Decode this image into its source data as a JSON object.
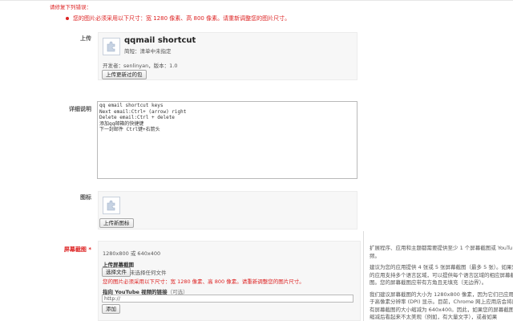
{
  "top_warning": "请修复下列错误：",
  "image_size_warning": "您的图片必须采用以下尺寸：宽 1280 像素、高 800 像素。请重新调整您的图片尺寸。",
  "upload": {
    "label": "上传",
    "app_name": "qqmail shortcut",
    "summary_label": "简短：",
    "summary_value": "清单中未指定",
    "meta": "开发者：senlinyan，版本：1.0",
    "button": "上传更新过的包"
  },
  "description": {
    "label": "详细说明",
    "lines": [
      "qq email shortcut keys",
      "Next email:Ctrl+ (arrow) right",
      "Delete email:Ctrl + delete",
      "添加qq邮箱的快捷键",
      "下一封邮件 Ctrl键+右箭头"
    ]
  },
  "icon": {
    "label": "图标",
    "button": "上传新图标"
  },
  "screenshots": {
    "label": "屏幕截图",
    "required_mark": "*",
    "size_hint": "1280x800 或 640x400",
    "upload_label": "上传屏幕截图",
    "choose_file_button": "选择文件",
    "no_file_text": "未选择任何文件",
    "error": "您的图片必须采用以下尺寸：宽 1280 像素、高 800 像素。请重新调整您的图片尺寸。",
    "youtube_label": "指向 YouTube 视频的链接",
    "youtube_optional": "（可选）",
    "url_value": "http://",
    "add_button": "添加"
  },
  "help": {
    "lines": [
      "扩展程序、应用和主题都需要提供至少 1 个屏幕截图或 YouTu",
      "频。",
      "",
      "建议为您的应用提供 4 张或 5 张屏幕截图（最多 5 张）。如果您",
      "的应用支持多个语言区域，可以提供每个语言区域的相应屏幕截",
      "图。您的屏幕截图应带有方角且无填充（无边界）。",
      "",
      "我们建议屏幕截图的大小为 1280x800 像素，因为它们已应用于",
      "于高像素分辨率 (DPI) 显示。目前，Chrome 网上应用店会将屏",
      "有屏幕截图的大小缩减为 640x400。因此，如果您的屏幕截图的",
      "缩减后看起来不太美观（例如，有大量文字），或者如果"
    ]
  },
  "colors": {
    "error_red": "#dd2222",
    "panel_bg": "#f7f7f7"
  }
}
